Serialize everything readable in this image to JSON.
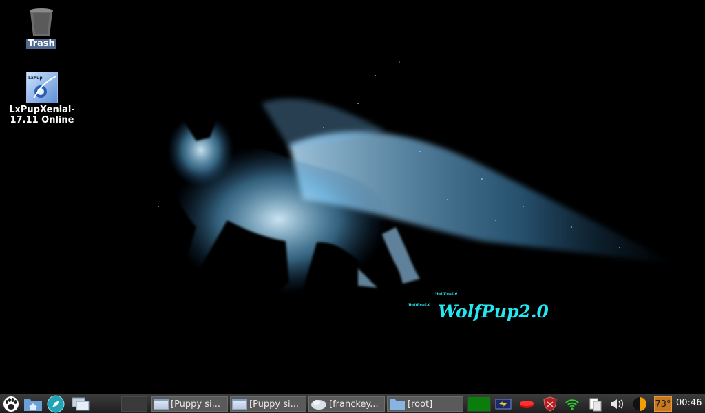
{
  "desktop": {
    "icons": [
      {
        "label": "Trash",
        "icon": "trash-icon"
      },
      {
        "label": "LxPupXenial-\n17.11 Online",
        "icon": "lxpup-app-icon",
        "icon_text": "LxPup"
      }
    ],
    "wallpaper": {
      "title": "WolfPup2.0",
      "small_text": "WolfPup2.0",
      "accent_color": "#26e6f2"
    }
  },
  "taskbar": {
    "launchers": [
      {
        "icon": "wolf-paw-menu-icon"
      },
      {
        "icon": "home-folder-icon"
      },
      {
        "icon": "compass-browser-icon"
      },
      {
        "icon": "window-switcher-icon"
      }
    ],
    "tasks": [
      {
        "label": "[Puppy si...",
        "icon": "window-icon"
      },
      {
        "label": "[Puppy si...",
        "icon": "window-icon"
      },
      {
        "label": "[franckey...",
        "icon": "cloud-icon"
      },
      {
        "label": "[root]",
        "icon": "folder-icon"
      }
    ],
    "tray": [
      {
        "icon": "cpu-monitor-icon",
        "color": "#008000"
      },
      {
        "icon": "power-meter-icon"
      },
      {
        "icon": "drive-mount-icon",
        "color": "#d01010"
      },
      {
        "icon": "firewall-shield-icon",
        "color": "#b02020"
      },
      {
        "icon": "wifi-icon",
        "color": "#2bd12b"
      },
      {
        "icon": "clipboard-icon"
      },
      {
        "icon": "volume-icon"
      },
      {
        "icon": "redshift-moon-icon",
        "color": "#f0a000"
      },
      {
        "icon": "temperature-icon",
        "value": "73°",
        "color": "#c8781e"
      }
    ],
    "clock": "00:46"
  }
}
